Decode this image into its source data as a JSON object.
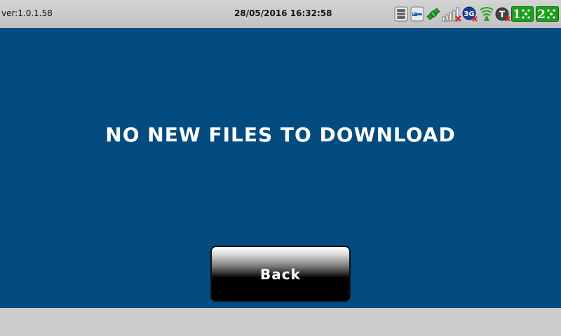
{
  "status_bar": {
    "version": "ver:1.0.1.58",
    "datetime": "28/05/2016 16:32:58",
    "icons": [
      {
        "name": "storage-icon"
      },
      {
        "name": "usb-icon"
      },
      {
        "name": "satellite-icon"
      },
      {
        "name": "signal-strength-icon",
        "state": "no-signal"
      },
      {
        "name": "3g-icon",
        "label": "3G",
        "state": "disconnected"
      },
      {
        "name": "wifi-icon"
      },
      {
        "name": "t-icon",
        "label": "T",
        "state": "disconnected"
      },
      {
        "name": "sim-1-icon",
        "label": "1"
      },
      {
        "name": "sim-2-icon",
        "label": "2"
      }
    ]
  },
  "main": {
    "message": "NO NEW FILES TO DOWNLOAD",
    "back_label": "Back"
  },
  "colors": {
    "background": "#044b80",
    "status_bar": "#cdcdcd",
    "button": "#000000",
    "sim_green": "#1aa01a",
    "alert_red": "#d81b1b"
  }
}
